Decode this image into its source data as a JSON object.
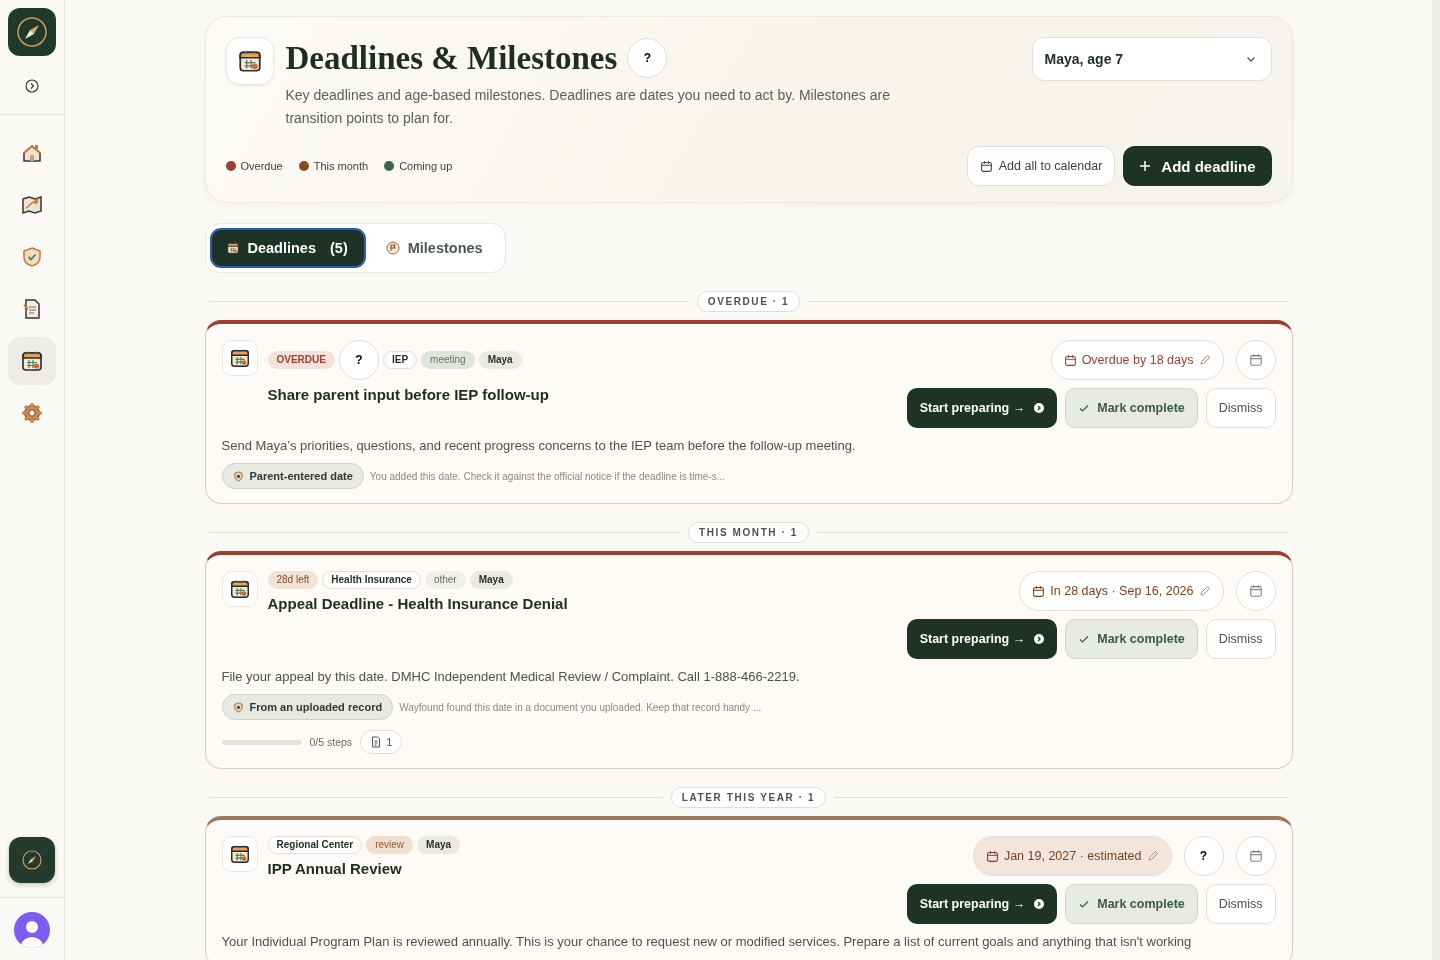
{
  "nav": [
    {
      "selected": false
    },
    {
      "selected": false
    },
    {
      "selected": false
    },
    {
      "selected": false
    },
    {
      "selected": true
    },
    {
      "selected": false
    }
  ],
  "header": {
    "title": "Deadlines & Milestones",
    "help": "?",
    "description": "Key deadlines and age-based milestones. Deadlines are dates you need to act by. Milestones are transition points to plan for.",
    "legend": [
      {
        "label": "Overdue",
        "color": "#9b3f2f"
      },
      {
        "label": "This month",
        "color": "#8b4a22"
      },
      {
        "label": "Coming up",
        "color": "#3f6248"
      }
    ],
    "child_select": "Maya, age 7",
    "calendar_button": "Add all to calendar",
    "add_button": "Add deadline"
  },
  "tabs": [
    {
      "label": "Deadlines",
      "count": "(5)",
      "selected": true
    },
    {
      "label": "Milestones",
      "selected": false
    }
  ],
  "groups": [
    {
      "label": "OVERDUE · 1",
      "cards": [
        {
          "color": "#9b3f2f",
          "tags": [
            {
              "text": "OVERDUE",
              "kind": "alert"
            },
            {
              "text": "?",
              "kind": "help"
            },
            {
              "text": "IEP",
              "kind": "outline"
            },
            {
              "text": "meeting",
              "kind": "meeting"
            },
            {
              "text": "Maya",
              "kind": "child"
            }
          ],
          "title": "Share parent input before IEP follow-up",
          "due": {
            "text": "Overdue by 18 days",
            "kind": "overdue"
          },
          "start": "Start preparing →",
          "mark": "Mark complete",
          "dismiss": "Dismiss",
          "description": "Send Maya’s priorities, questions, and recent progress concerns to the IEP team before the follow-up meeting.",
          "source": {
            "label": "Parent-entered date",
            "note": "You added this date. Check it against the official notice if the deadline is time-s..."
          }
        }
      ]
    },
    {
      "label": "THIS MONTH · 1",
      "cards": [
        {
          "color": "#9b3f2f",
          "tags": [
            {
              "text": "28d left",
              "kind": "countdown"
            },
            {
              "text": "Health Insurance",
              "kind": "outline"
            },
            {
              "text": "other",
              "kind": "muted"
            },
            {
              "text": "Maya",
              "kind": "child"
            }
          ],
          "title": "Appeal Deadline - Health Insurance Denial",
          "due": {
            "text": "In 28 days · Sep 16, 2026",
            "kind": "upcoming"
          },
          "start": "Start preparing →",
          "mark": "Mark complete",
          "dismiss": "Dismiss",
          "description": "File your appeal by this date. DMHC Independent Medical Review / Complaint. Call 1-888-466-2219.",
          "source": {
            "label": "From an uploaded record",
            "note": "Wayfound found this date in a document you uploaded. Keep that record handy ..."
          },
          "progress": {
            "level": 0,
            "text": "0/5 steps",
            "docs": "1"
          }
        }
      ]
    },
    {
      "label": "LATER THIS YEAR · 1",
      "cards": [
        {
          "color": "#a0765a",
          "tags": [
            {
              "text": "Regional Center",
              "kind": "outline"
            },
            {
              "text": "review",
              "kind": "review"
            },
            {
              "text": "Maya",
              "kind": "child"
            }
          ],
          "title": "IPP Annual Review",
          "due": {
            "text": "Jan 19, 2027 · estimated",
            "kind": "estimated"
          },
          "due_help": "?",
          "start": "Start preparing →",
          "mark": "Mark complete",
          "dismiss": "Dismiss",
          "description": "Your Individual Program Plan is reviewed annually. This is your chance to request new or modified services. Prepare a list of current goals and anything that isn't working"
        }
      ]
    }
  ]
}
